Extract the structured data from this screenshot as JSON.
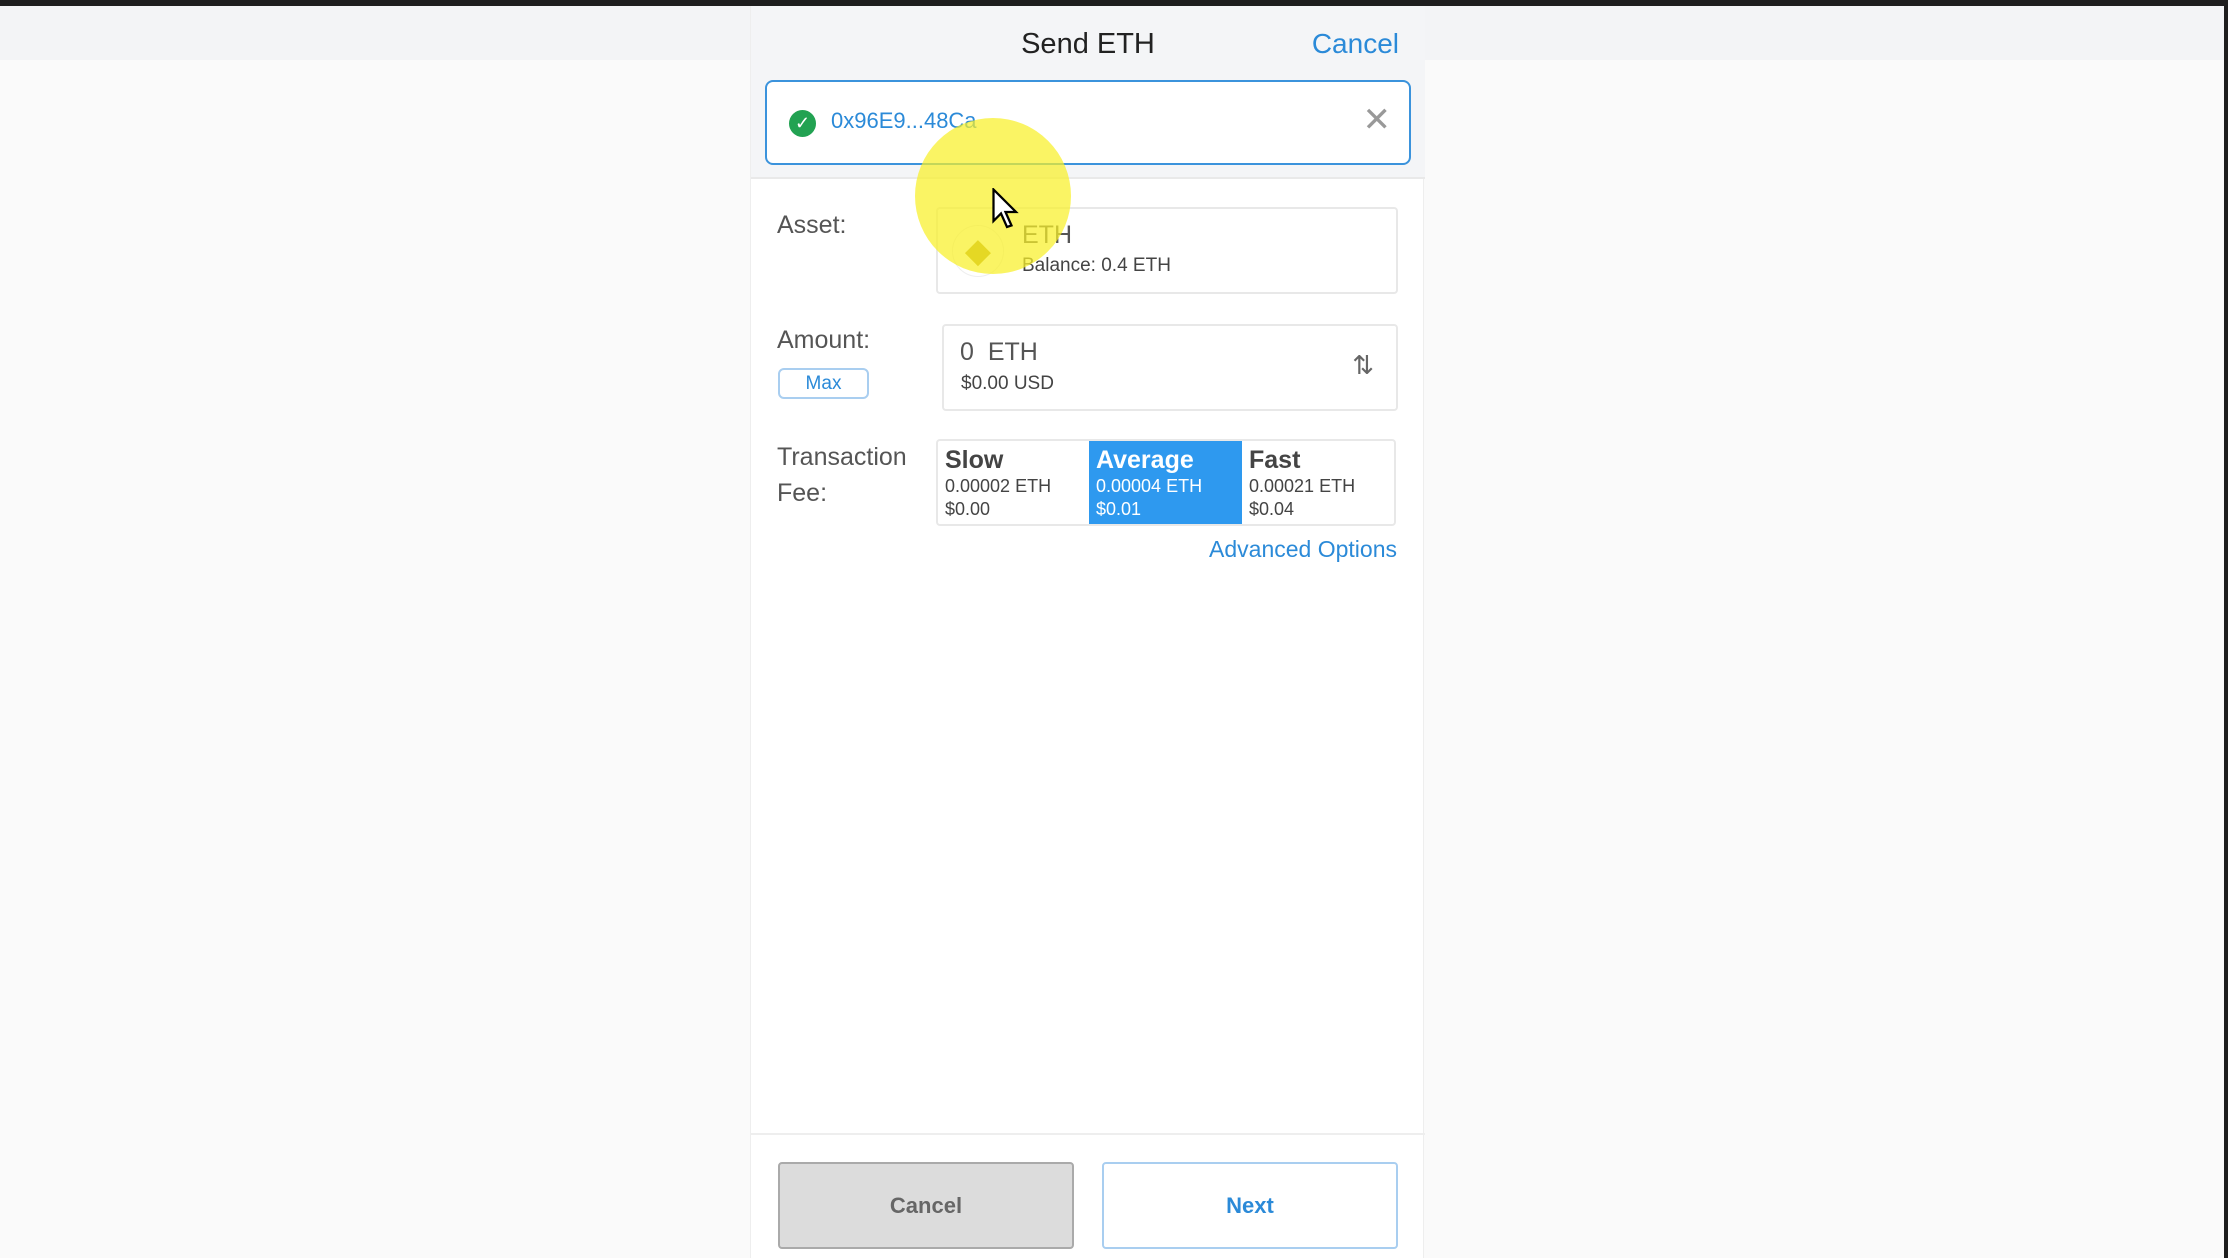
{
  "header": {
    "title": "Send ETH",
    "cancel_label": "Cancel"
  },
  "recipient": {
    "address": "0x96E9...48Ca",
    "status_icon": "check-circle-icon",
    "clear_icon": "close-icon"
  },
  "asset": {
    "label": "Asset:",
    "symbol": "ETH",
    "balance": "Balance: 0.4 ETH",
    "icon": "ethereum-icon"
  },
  "amount": {
    "label": "Amount:",
    "max_label": "Max",
    "value": "0",
    "unit": "ETH",
    "usd": "$0.00 USD",
    "swap_icon": "swap-vertical-icon"
  },
  "fee": {
    "label_line1": "Transaction",
    "label_line2": "Fee:",
    "options": [
      {
        "name": "Slow",
        "eth": "0.00002 ETH",
        "usd": "$0.00",
        "selected": false
      },
      {
        "name": "Average",
        "eth": "0.00004 ETH",
        "usd": "$0.01",
        "selected": true
      },
      {
        "name": "Fast",
        "eth": "0.00021 ETH",
        "usd": "$0.04",
        "selected": false
      }
    ],
    "advanced_label": "Advanced Options"
  },
  "footer": {
    "cancel_label": "Cancel",
    "next_label": "Next"
  },
  "colors": {
    "accent": "#2b8ad8",
    "selected_fee": "#2e99ef",
    "success": "#22a252"
  }
}
